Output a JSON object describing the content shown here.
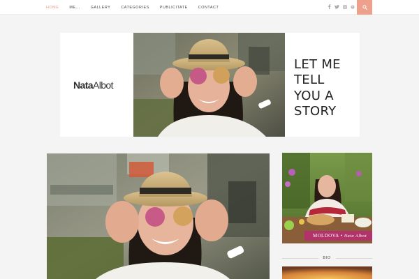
{
  "nav": {
    "items": [
      {
        "label": "HOME",
        "active": true
      },
      {
        "label": "ME...",
        "active": false
      },
      {
        "label": "GALLERY",
        "active": false
      },
      {
        "label": "CATEGORIES",
        "active": false
      },
      {
        "label": "PUBLICITATE",
        "active": false
      },
      {
        "label": "CONTACT",
        "active": false
      }
    ]
  },
  "social": {
    "icons": [
      "facebook-icon",
      "twitter-icon",
      "instagram-icon",
      "pinterest-icon"
    ]
  },
  "search": {
    "icon": "search-icon",
    "color": "#eea08c"
  },
  "header": {
    "logo_bold": "Nata",
    "logo_regular": "Albot",
    "tagline": [
      "LET ME",
      "TELL",
      "YOU A",
      "STORY"
    ]
  },
  "sidebar": {
    "promo_title": "MOLDOVA",
    "promo_separator": "•",
    "promo_author": "Nata Albot",
    "bio_heading": "BIO"
  },
  "colors": {
    "accent": "#eea08c",
    "active_nav": "#e79b86",
    "promo_banner": "#b2336a"
  }
}
